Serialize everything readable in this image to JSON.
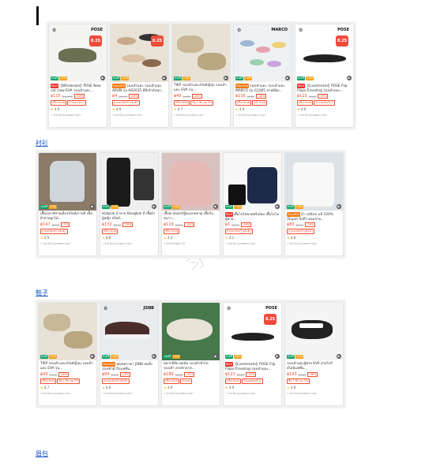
{
  "categories": {
    "shirts": "衬衫",
    "shoes": "鞋子",
    "bags": "眉包"
  },
  "row1": [
    {
      "brand": "POSE",
      "promo": "8.25",
      "tag": "Mall",
      "tag_style": "r",
      "title": "【Wholesale】POSE New cat claw EVA รองเท้าแตะ...",
      "price": "฿115",
      "old": "฿1,400",
      "disc": "-92%",
      "chips": [
        "ฟรีค่าจัดส่ง",
        "จ่ายปลายทาง"
      ],
      "rating": "4.9",
      "loc": "จังหวัดกรุงเทพมหานคร",
      "img": "slide-green"
    },
    {
      "brand": "",
      "promo": "8.25",
      "tag": "Favorite",
      "tag_style": "o",
      "title": "รองเท้าแตะ รองเท้าแตะ ARUN รุ่น AR2035 ที่ดีเข้ากับทุก...",
      "price": "฿4",
      "old": "฿4.00",
      "disc": "-88%",
      "chips": [
        "ส่วนลดจัดสร้างสินค้า"
      ],
      "rating": "4.9",
      "loc": "จังหวัดกรุงเทพมหานคร",
      "img": "sandals-many"
    },
    {
      "brand": "",
      "promo": "",
      "tag": "",
      "tag_style": "",
      "title": "TIKP รองเท้าแตะสไตล์ญี่ปุ่น รองเท้าแตะ EVA รุ่น...",
      "price": "฿49",
      "old": "฿120",
      "disc": "-60%",
      "chips": [
        "ฟรีค่าจัดส่ง",
        "ซื้อ 2 ชิ้น ลด 5%"
      ],
      "rating": "4.7",
      "loc": "จังหวัดกรุงเทพมหานคร",
      "img": "slide-beige"
    },
    {
      "brand": "MARCO",
      "promo": "",
      "tag": "Favorite",
      "tag_style": "o",
      "title": "รองเท้าแตะ รองเท้าแตะ MARCO รุ่น G1005 ลายมินิม...",
      "price": "฿216",
      "old": "฿400",
      "disc": "-46%",
      "chips": [
        "ฟรีค่าจัดส่ง",
        "VIP Point"
      ],
      "rating": "4.9",
      "loc": "จังหวัดกรุงเทพมหานคร",
      "img": "sandals-color"
    },
    {
      "brand": "POSE",
      "promo": "8.25",
      "tag": "Mall",
      "tag_style": "r",
      "title": "【Livestream】POSE Flip Flops-Traveling รองเท้าแตะ...",
      "price": "฿123",
      "old": "฿300",
      "disc": "-59%",
      "chips": [
        "ฟรีค่าจัดส่ง",
        "ส่วนลดจัดสร้าง"
      ],
      "rating": "4.9",
      "loc": "จังหวัดกรุงเทพมหานคร",
      "img": "flipflop"
    }
  ],
  "row2": [
    {
      "brand": "",
      "promo": "",
      "tag": "",
      "tag_style": "",
      "title": "เสื้อเบลาส์สายเดี่ยวสไตล์เกาหลี เนื้อผ้าลายลูกไม้...",
      "price": "฿147",
      "old": "฿200",
      "disc": "-1%",
      "chips": [
        "ส่วนลดจัดสร้างสินค้า"
      ],
      "rating": "4.9",
      "loc": "จังหวัดกรุงเทพมหานคร",
      "img": "blouse"
    },
    {
      "brand": "",
      "promo": "",
      "tag": "",
      "tag_style": "",
      "title": "Hotpink ผ้าลาย Bangkok สี เสื้อผ้าผู้หญิง สไตล์...",
      "price": "฿132",
      "old": "฿200",
      "disc": "-39%",
      "chips": [
        "ฟรีค่าจัดส่ง"
      ],
      "rating": "4.8",
      "loc": "จังหวัดกรุงเทพมหานคร",
      "img": "black-outfit"
    },
    {
      "brand": "",
      "promo": "",
      "tag": "",
      "tag_style": "",
      "title": "เสื้อสเวตเตอร์ฮู้ดแบบหลวม เสื้อกันหนาว...",
      "price": "฿119",
      "old": "฿200",
      "disc": "-40%",
      "chips": [
        "ฟรีค่าจัดส่ง"
      ],
      "rating": "4.4",
      "loc": "จังหวัดปทุมธานี",
      "img": "hoodie"
    },
    {
      "brand": "",
      "promo": "",
      "tag": "Mall",
      "tag_style": "r",
      "title": "เสื้อโปโลชายพรีเมียม เสื้อโปโลผู้ชาย...",
      "price": "฿1",
      "old": "฿300",
      "disc": "-98%",
      "chips": [
        "ส่วนลดจัดสร้างสินค้า"
      ],
      "rating": "4.2",
      "loc": "จังหวัดกรุงเทพมหานคร",
      "img": "polo"
    },
    {
      "brand": "",
      "promo": "",
      "tag": "Favorite",
      "tag_style": "o",
      "title": "ผ้า cotton แท้ 100% (Super Soft) ทอมลาย...",
      "price": "฿80",
      "old": "฿100",
      "disc": "-20%",
      "chips": [
        "ส่วนลดจัดสร้างสินค้า"
      ],
      "rating": "4.9",
      "loc": "จังหวัดกรุงเทพมหานคร",
      "img": "tshirt"
    }
  ],
  "row3": [
    {
      "brand": "",
      "promo": "",
      "tag": "",
      "tag_style": "",
      "title": "TIKP รองเท้าแตะสไตล์ญี่ปุ่น รองเท้าแตะ EVA รุ่น...",
      "price": "฿49",
      "old": "฿120",
      "disc": "-60%",
      "chips": [
        "ฟรีค่าจัดส่ง",
        "ซื้อ 2 ชิ้น ลด 5%"
      ],
      "rating": "4.7",
      "loc": "จังหวัดกรุงเทพมหานคร",
      "img": "slide-beige"
    },
    {
      "brand": "JSNB",
      "promo": "",
      "tag": "Favorite",
      "tag_style": "o",
      "title": "ลด/ลดราคา JSNB ลดทั้ง รองเท้าผ้าใบแฟชั่น...",
      "price": "฿89",
      "old": "฿150",
      "disc": "-40%",
      "chips": [
        "ส่วนลดจัดสร้างสินค้า"
      ],
      "rating": "4.9",
      "loc": "จังหวัดกรุงเทพมหานคร",
      "img": "sneaker"
    },
    {
      "brand": "",
      "promo": "",
      "tag": "",
      "tag_style": "",
      "title": "หลากสีสัน สุดทัน รองเท้าหัวโต รองเท้า ลายซาลาส...",
      "price": "฿189",
      "old": "฿300",
      "disc": "-37%",
      "chips": [
        "ฟรีค่าจัดส่ง",
        "ส่วนลด"
      ],
      "rating": "4.9",
      "loc": "จังหวัดกรุงเทพมหานคร",
      "img": "crocs"
    },
    {
      "brand": "POSE",
      "promo": "8.25",
      "tag": "Mall",
      "tag_style": "r",
      "title": "【Livestream】POSE Flip Flops-Traveling รองเท้าแตะ...",
      "price": "฿123",
      "old": "฿300",
      "disc": "-59%",
      "chips": [
        "ฟรีค่าจัดส่ง",
        "ส่วนลดจัดสร้าง"
      ],
      "rating": "4.9",
      "loc": "จังหวัดกรุงเทพมหานคร",
      "img": "flipflop"
    },
    {
      "brand": "",
      "promo": "",
      "tag": "",
      "tag_style": "",
      "title": "รองเท้าแตะผู้ชาย EVA สายไขว้ สไตล์แฟชั่น...",
      "price": "฿193",
      "old": "฿300",
      "disc": "-36%",
      "chips": [
        "ซื้อ 2 ชิ้น ลด 5%"
      ],
      "rating": "4.9",
      "loc": "จังหวัดกรุงเทพมหานคร",
      "img": "sandal-bw"
    }
  ]
}
